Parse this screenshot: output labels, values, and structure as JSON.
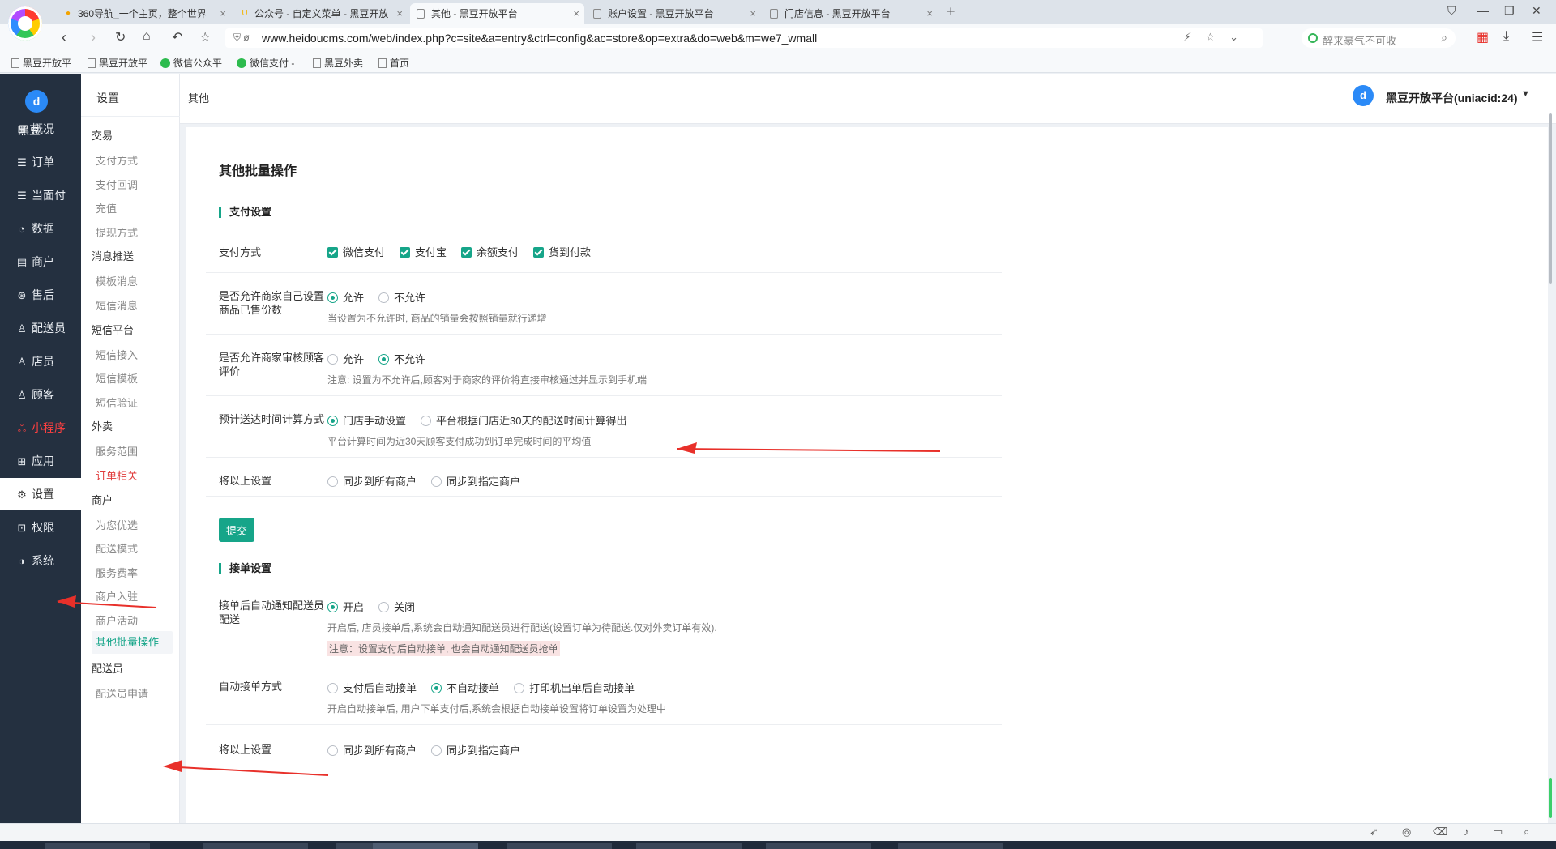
{
  "browser": {
    "tabs": [
      {
        "title": "360导航_一个主页，整个世界",
        "fav": "●",
        "fav_color": "#f2a300",
        "active": false
      },
      {
        "title": "公众号 - 自定义菜单 - 黑豆开放",
        "fav": "U",
        "fav_color": "#f3b400",
        "active": false
      },
      {
        "title": "其他 - 黑豆开放平台",
        "fav": "",
        "fav_color": "#ffffff",
        "active": true
      },
      {
        "title": "账户设置 - 黑豆开放平台",
        "fav": "",
        "fav_color": "#ffffff",
        "active": false
      },
      {
        "title": "门店信息 - 黑豆开放平台",
        "fav": "",
        "fav_color": "#ffffff",
        "active": false
      }
    ],
    "url": "www.heidoucms.com/web/index.php?c=site&a=entry&ctrl=config&ac=store&op=extra&do=web&m=we7_wmall",
    "search_placeholder": "醉来豪气不可收",
    "bookmarks": [
      "黑豆开放平",
      "黑豆开放平",
      "微信公众平",
      "微信支付 -",
      "黑豆外卖",
      "首页"
    ]
  },
  "left_nav": {
    "brand": "黑豆...",
    "brand_logo": "d",
    "items": [
      {
        "label": "概况",
        "icon": "dashboard-icon",
        "glyph": "⊞",
        "active": false,
        "red": false
      },
      {
        "label": "订单",
        "icon": "order-icon",
        "glyph": "☰",
        "active": false,
        "red": false
      },
      {
        "label": "当面付",
        "icon": "pay-icon",
        "glyph": "☰",
        "active": false,
        "red": false
      },
      {
        "label": "数据",
        "icon": "data-icon",
        "glyph": "◔",
        "active": false,
        "red": false
      },
      {
        "label": "商户",
        "icon": "merchant-icon",
        "glyph": "▤",
        "active": false,
        "red": false
      },
      {
        "label": "售后",
        "icon": "aftersale-icon",
        "glyph": "⊛",
        "active": false,
        "red": false
      },
      {
        "label": "配送员",
        "icon": "courier-icon",
        "glyph": "♙",
        "active": false,
        "red": false
      },
      {
        "label": "店员",
        "icon": "clerk-icon",
        "glyph": "♙",
        "active": false,
        "red": false
      },
      {
        "label": "顾客",
        "icon": "customer-icon",
        "glyph": "♙",
        "active": false,
        "red": false
      },
      {
        "label": "小程序",
        "icon": "miniapp-icon",
        "glyph": "ஃ",
        "active": false,
        "red": true
      },
      {
        "label": "应用",
        "icon": "apps-icon",
        "glyph": "⊞",
        "active": false,
        "red": false
      },
      {
        "label": "设置",
        "icon": "gear-icon",
        "glyph": "⚙",
        "active": true,
        "red": false
      },
      {
        "label": "权限",
        "icon": "lock-icon",
        "glyph": "⊡",
        "active": false,
        "red": false
      },
      {
        "label": "系统",
        "icon": "system-icon",
        "glyph": "◑",
        "active": false,
        "red": false
      }
    ]
  },
  "sub_nav": {
    "title": "设置",
    "entries": [
      {
        "type": "group",
        "label": "交易"
      },
      {
        "type": "item",
        "label": "支付方式"
      },
      {
        "type": "item",
        "label": "支付回调"
      },
      {
        "type": "item",
        "label": "充值"
      },
      {
        "type": "item",
        "label": "提现方式"
      },
      {
        "type": "group",
        "label": "消息推送"
      },
      {
        "type": "item",
        "label": "模板消息"
      },
      {
        "type": "item",
        "label": "短信消息"
      },
      {
        "type": "group",
        "label": "短信平台"
      },
      {
        "type": "item",
        "label": "短信接入"
      },
      {
        "type": "item",
        "label": "短信模板"
      },
      {
        "type": "item",
        "label": "短信验证"
      },
      {
        "type": "group",
        "label": "外卖"
      },
      {
        "type": "item",
        "label": "服务范围"
      },
      {
        "type": "item",
        "label": "订单相关",
        "state": "red"
      },
      {
        "type": "group",
        "label": "商户"
      },
      {
        "type": "item",
        "label": "为您优选"
      },
      {
        "type": "item",
        "label": "配送模式"
      },
      {
        "type": "item",
        "label": "服务费率"
      },
      {
        "type": "item",
        "label": "商户入驻"
      },
      {
        "type": "item",
        "label": "商户活动"
      },
      {
        "type": "item",
        "label": "其他批量操作",
        "state": "active"
      },
      {
        "type": "group",
        "label": "配送员"
      },
      {
        "type": "item",
        "label": "配送员申请"
      }
    ]
  },
  "topbar": {
    "breadcrumb": "其他",
    "account": "黑豆开放平台(uniacid:24)"
  },
  "page": {
    "title": "其他批量操作",
    "payment_section": "支付设置",
    "payment_methods": {
      "label": "支付方式",
      "options": [
        "微信支付",
        "支付宝",
        "余额支付",
        "货到付款"
      ]
    },
    "allow_sold_count": {
      "label": "是否允许商家自己设置商品已售份数",
      "options": [
        "允许",
        "不允许"
      ],
      "selected": 0,
      "help": "当设置为不允许时, 商品的销量会按照销量就行递增"
    },
    "allow_review": {
      "label": "是否允许商家审核顾客评价",
      "options": [
        "允许",
        "不允许"
      ],
      "selected": 1,
      "help": "注意: 设置为不允许后,顾客对于商家的评价将直接审核通过并显示到手机端"
    },
    "delivery_time": {
      "label": "预计送达时间计算方式",
      "options": [
        "门店手动设置",
        "平台根据门店近30天的配送时间计算得出"
      ],
      "selected": 0,
      "help": "平台计算时间为近30天顾客支付成功到订单完成时间的平均值"
    },
    "apply_above": {
      "label": "将以上设置",
      "options": [
        "同步到所有商户",
        "同步到指定商户"
      ],
      "selected": -1
    },
    "submit": "提交",
    "order_section": "接单设置",
    "auto_notify": {
      "label": "接单后自动通知配送员配送",
      "options": [
        "开启",
        "关闭"
      ],
      "selected": 0,
      "help": "开启后, 店员接单后,系统会自动通知配送员进行配送(设置订单为待配送.仅对外卖订单有效).",
      "warn": "注意：设置支付后自动接单, 也会自动通知配送员抢单"
    },
    "auto_accept": {
      "label": "自动接单方式",
      "options": [
        "支付后自动接单",
        "不自动接单",
        "打印机出单后自动接单"
      ],
      "selected": 1,
      "help": "开启自动接单后, 用户下单支付后,系统会根据自动接单设置将订单设置为处理中"
    },
    "apply_above_2": {
      "label": "将以上设置",
      "options": [
        "同步到所有商户",
        "同步到指定商户"
      ],
      "selected": -1
    }
  },
  "colors": {
    "accent": "#16a589",
    "nav_bg": "#243040",
    "annotation_red": "#e8302a"
  }
}
